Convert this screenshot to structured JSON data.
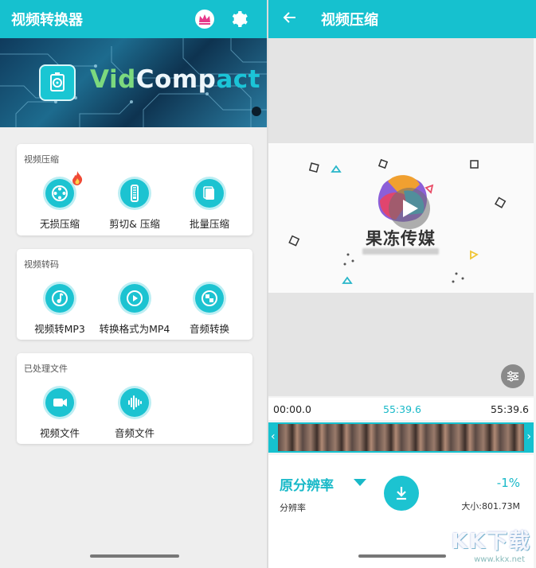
{
  "left": {
    "title": "视频转换器",
    "banner": {
      "logo_vid": "Vid",
      "logo_comp": "Comp",
      "logo_act": "act"
    },
    "cards": [
      {
        "title": "视频压缩",
        "items": [
          {
            "label": "无损压缩",
            "icon": "film-reel-icon"
          },
          {
            "label": "剪切& 压缩",
            "icon": "zipper-icon"
          },
          {
            "label": "批量压缩",
            "icon": "stack-icon"
          }
        ]
      },
      {
        "title": "视频转码",
        "items": [
          {
            "label": "视频转MP3",
            "icon": "music-note-icon"
          },
          {
            "label": "转换格式为MP4",
            "icon": "play-icon"
          },
          {
            "label": "音频转换",
            "icon": "convert-icon"
          }
        ]
      },
      {
        "title": "已处理文件",
        "items": [
          {
            "label": "视频文件",
            "icon": "video-camera-icon"
          },
          {
            "label": "音频文件",
            "icon": "audio-wave-icon"
          }
        ]
      }
    ]
  },
  "right": {
    "title": "视频压缩",
    "media_name": "果冻传媒",
    "time_start": "00:00.0",
    "time_mid": "55:39.6",
    "time_end": "55:39.6",
    "resolution_label": "原分辨率",
    "resolution_sub": "分辨率",
    "percent": "-1%",
    "size": "大小:801.73M"
  },
  "watermark": {
    "text": "KK下载",
    "url": "www.kkx.net"
  },
  "colors": {
    "accent": "#16c1cf",
    "accent_text": "#18b9c8"
  }
}
